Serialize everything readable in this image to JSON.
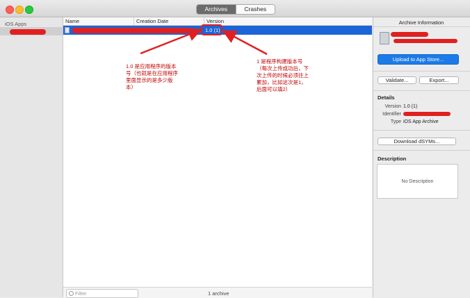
{
  "toolbar": {
    "tabs": [
      {
        "label": "Archives",
        "active": true
      },
      {
        "label": "Crashes",
        "active": false
      }
    ]
  },
  "sidebar": {
    "section_title": "iOS Apps"
  },
  "table": {
    "columns": [
      "Name",
      "Creation Date",
      "Version"
    ],
    "rows": [
      {
        "version": "1.0 (1)"
      }
    ]
  },
  "annotations": {
    "left_note": [
      "1.0 是应用程序的版本",
      "号（也就是在应用程序",
      "里面显示的是多少版",
      "本）"
    ],
    "right_note": [
      "1 是程序构建版本号",
      "（每次上传成功后，下",
      "次上传的时候必须往上",
      "累加，比如这次是1，",
      "后面可以填2）"
    ]
  },
  "bottombar": {
    "filter_placeholder": "Filter",
    "count": "1 archive"
  },
  "panel": {
    "title": "Archive Information",
    "upload_label": "Upload to App Store...",
    "validate_label": "Validate...",
    "export_label": "Export...",
    "details_title": "Details",
    "details": {
      "version_key": "Version",
      "version_value": "1.0 (1)",
      "identifier_key": "Identifier",
      "type_key": "Type",
      "type_value": "iOS App Archive"
    },
    "dsyms_label": "Download dSYMs...",
    "description_title": "Description",
    "description_placeholder": "No Description"
  },
  "colors": {
    "selection": "#1d64d6",
    "annotation_red": "#e02020",
    "primary_button": "#1c7be8"
  }
}
